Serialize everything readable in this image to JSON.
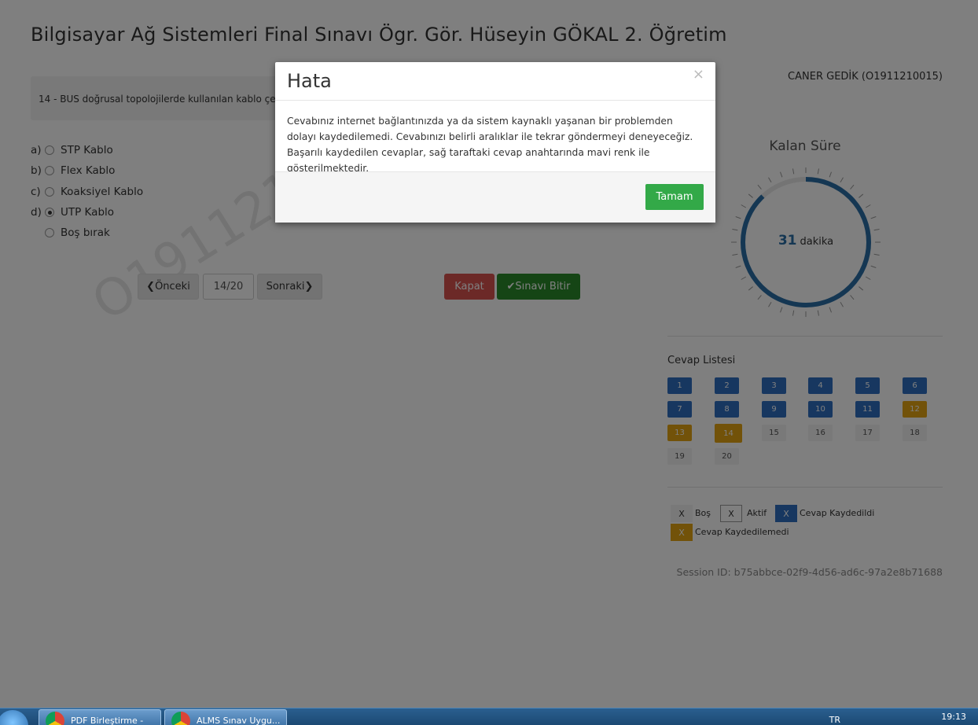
{
  "exam": {
    "title": "Bilgisayar Ağ Sistemleri Final Sınavı Ögr. Gör. Hüseyin GÖKAL 2. Öğretim",
    "student": "CANER GEDİK (O1911210015)",
    "watermark": "O191121",
    "question": "14 -  BUS doğrusal topolojilerde kullanılan kablo çeşidi hangisidir?",
    "options": [
      {
        "letter": "a)",
        "label": "STP Kablo"
      },
      {
        "letter": "b)",
        "label": "Flex Kablo"
      },
      {
        "letter": "c)",
        "label": "Koaksiyel Kablo"
      },
      {
        "letter": "d)",
        "label": "UTP Kablo"
      },
      {
        "letter": "",
        "label": "Boş bırak"
      }
    ],
    "selected_option": "d)"
  },
  "nav": {
    "prev_label": "❮Önceki",
    "page_label": "14/20",
    "next_label": "Sonraki❯",
    "close_label": "Kapat",
    "finish_label": "✔Sınavı Bitir"
  },
  "timer": {
    "label": "Kalan Süre",
    "value": "31",
    "unit": "dakika",
    "progress": 0.88
  },
  "answers": {
    "title": "Cevap Listesi",
    "items": [
      {
        "n": "1",
        "status": "saved"
      },
      {
        "n": "2",
        "status": "saved"
      },
      {
        "n": "3",
        "status": "saved"
      },
      {
        "n": "4",
        "status": "saved"
      },
      {
        "n": "5",
        "status": "saved"
      },
      {
        "n": "6",
        "status": "saved"
      },
      {
        "n": "7",
        "status": "saved"
      },
      {
        "n": "8",
        "status": "saved"
      },
      {
        "n": "9",
        "status": "saved"
      },
      {
        "n": "10",
        "status": "saved"
      },
      {
        "n": "11",
        "status": "saved"
      },
      {
        "n": "12",
        "status": "notsaved"
      },
      {
        "n": "13",
        "status": "notsaved"
      },
      {
        "n": "14",
        "status": "active"
      },
      {
        "n": "15",
        "status": "empty"
      },
      {
        "n": "16",
        "status": "empty"
      },
      {
        "n": "17",
        "status": "empty"
      },
      {
        "n": "18",
        "status": "empty"
      },
      {
        "n": "19",
        "status": "empty"
      },
      {
        "n": "20",
        "status": "empty"
      }
    ]
  },
  "legend": {
    "mark": "X",
    "empty": "Boş",
    "active": "Aktif",
    "saved": "Cevap Kaydedildi",
    "notsaved": "Cevap Kaydedilemedi"
  },
  "session": "Session ID: b75abbce-02f9-4d56-ad6c-97a2e8b71688",
  "modal": {
    "title": "Hata",
    "close": "×",
    "body": "Cevabınız internet bağlantınızda ya da sistem kaynaklı yaşanan bir problemden dolayı kaydedilemedi. Cevabınızı belirli aralıklar ile tekrar göndermeyi deneyeceğiz. Başarılı kaydedilen cevaplar, sağ taraftaki cevap anahtarında mavi renk ile gösterilmektedir.",
    "ok": "Tamam"
  },
  "taskbar": {
    "tasks": [
      "PDF Birleştirme -",
      "ALMS Sınav Uygu..."
    ],
    "lang": "TR",
    "time": "19:13"
  },
  "colors": {
    "saved": "#2f6fc0",
    "notsaved": "#e5a412",
    "ok_button": "#33a948",
    "close_button": "#d9534f",
    "finish_button": "#2b8a2b"
  }
}
